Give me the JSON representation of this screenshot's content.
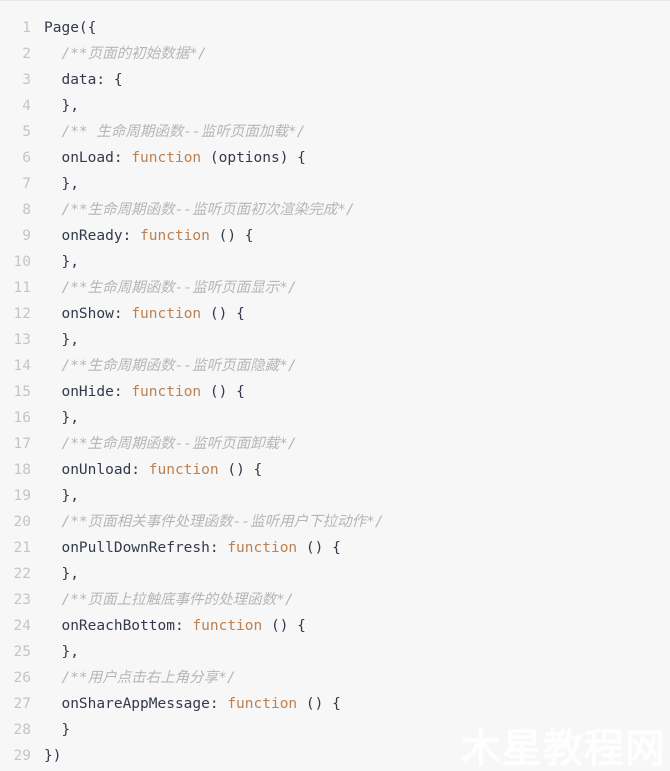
{
  "editor": {
    "language": "javascript",
    "background_color": "#f7f7f7",
    "text_color": "#32394a",
    "comment_color": "#b6b6b6",
    "keyword_color": "#bd8050",
    "line_number_color": "#c5c5c5",
    "first_line_number": 1,
    "last_line_number": 29,
    "total_lines": 29
  },
  "lines": [
    {
      "n": "1",
      "type": "code",
      "pre": "Page({",
      "kw": "",
      "post": ""
    },
    {
      "n": "2",
      "type": "comment",
      "text": "  /**页面的初始数据*/"
    },
    {
      "n": "3",
      "type": "code",
      "pre": "  data: {",
      "kw": "",
      "post": ""
    },
    {
      "n": "4",
      "type": "code",
      "pre": "  },",
      "kw": "",
      "post": ""
    },
    {
      "n": "5",
      "type": "comment",
      "text": "  /** 生命周期函数--监听页面加载*/"
    },
    {
      "n": "6",
      "type": "code",
      "pre": "  onLoad: ",
      "kw": "function",
      "post": " (options) {"
    },
    {
      "n": "7",
      "type": "code",
      "pre": "  },",
      "kw": "",
      "post": ""
    },
    {
      "n": "8",
      "type": "comment",
      "text": "  /**生命周期函数--监听页面初次渲染完成*/"
    },
    {
      "n": "9",
      "type": "code",
      "pre": "  onReady: ",
      "kw": "function",
      "post": " () {"
    },
    {
      "n": "10",
      "type": "code",
      "pre": "  },",
      "kw": "",
      "post": ""
    },
    {
      "n": "11",
      "type": "comment",
      "text": "  /**生命周期函数--监听页面显示*/"
    },
    {
      "n": "12",
      "type": "code",
      "pre": "  onShow: ",
      "kw": "function",
      "post": " () {"
    },
    {
      "n": "13",
      "type": "code",
      "pre": "  },",
      "kw": "",
      "post": ""
    },
    {
      "n": "14",
      "type": "comment",
      "text": "  /**生命周期函数--监听页面隐藏*/"
    },
    {
      "n": "15",
      "type": "code",
      "pre": "  onHide: ",
      "kw": "function",
      "post": " () {"
    },
    {
      "n": "16",
      "type": "code",
      "pre": "  },",
      "kw": "",
      "post": ""
    },
    {
      "n": "17",
      "type": "comment",
      "text": "  /**生命周期函数--监听页面卸载*/"
    },
    {
      "n": "18",
      "type": "code",
      "pre": "  onUnload: ",
      "kw": "function",
      "post": " () {"
    },
    {
      "n": "19",
      "type": "code",
      "pre": "  },",
      "kw": "",
      "post": ""
    },
    {
      "n": "20",
      "type": "comment",
      "text": "  /**页面相关事件处理函数--监听用户下拉动作*/"
    },
    {
      "n": "21",
      "type": "code",
      "pre": "  onPullDownRefresh: ",
      "kw": "function",
      "post": " () {"
    },
    {
      "n": "22",
      "type": "code",
      "pre": "  },",
      "kw": "",
      "post": ""
    },
    {
      "n": "23",
      "type": "comment",
      "text": "  /**页面上拉触底事件的处理函数*/"
    },
    {
      "n": "24",
      "type": "code",
      "pre": "  onReachBottom: ",
      "kw": "function",
      "post": " () {"
    },
    {
      "n": "25",
      "type": "code",
      "pre": "  },",
      "kw": "",
      "post": ""
    },
    {
      "n": "26",
      "type": "comment",
      "text": "  /**用户点击右上角分享*/"
    },
    {
      "n": "27",
      "type": "code",
      "pre": "  onShareAppMessage: ",
      "kw": "function",
      "post": " () {"
    },
    {
      "n": "28",
      "type": "code",
      "pre": "  }",
      "kw": "",
      "post": ""
    },
    {
      "n": "29",
      "type": "code",
      "pre": "})",
      "kw": "",
      "post": ""
    }
  ],
  "watermark": {
    "text": "木星教程网",
    "color": "#ffffff"
  }
}
